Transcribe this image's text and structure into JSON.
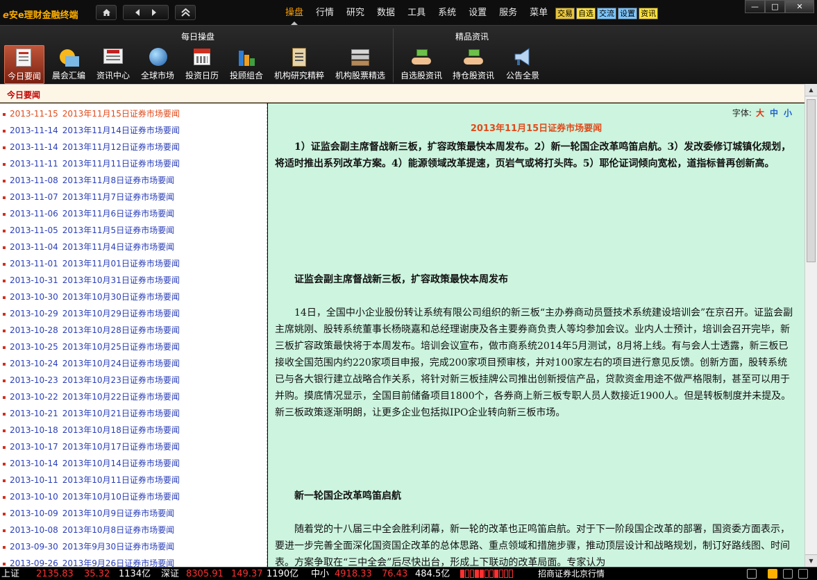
{
  "titlebar": {
    "logo_prefix": "e",
    "logo_text": "安e理财金融终端",
    "menu": [
      "操盘",
      "行情",
      "研究",
      "数据",
      "工具",
      "系统",
      "设置",
      "服务",
      "菜单"
    ],
    "active_menu": "操盘",
    "quick_buttons": [
      "交易",
      "自选",
      "交流",
      "设置",
      "资讯"
    ],
    "window_controls": [
      "—",
      "□",
      "✕"
    ]
  },
  "toolbar": {
    "group1_title": "每日操盘",
    "group2_title": "精品资讯",
    "tools": [
      {
        "label": "今日要闻",
        "icon": "newspaper-icon",
        "selected": true
      },
      {
        "label": "晨会汇编",
        "icon": "sunrise-icon"
      },
      {
        "label": "资讯中心",
        "icon": "news-screen-icon"
      },
      {
        "label": "全球市场",
        "icon": "globe-icon"
      },
      {
        "label": "投资日历",
        "icon": "calendar-icon"
      },
      {
        "label": "投顾组合",
        "icon": "bar-blocks-icon"
      },
      {
        "label": "机构研究精粹",
        "icon": "clipboard-icon"
      },
      {
        "label": "机构股票精选",
        "icon": "stack-icon"
      },
      {
        "label": "自选股资讯",
        "icon": "hand-money-icon"
      },
      {
        "label": "持仓股资讯",
        "icon": "hand-coins-icon"
      },
      {
        "label": "公告全景",
        "icon": "megaphone-icon"
      }
    ]
  },
  "section_title": "今日要闻",
  "news_list": [
    {
      "date": "2013-11-15",
      "title": "2013年11月15日证券市场要闻",
      "active": true
    },
    {
      "date": "2013-11-14",
      "title": "2013年11月14日证券市场要闻"
    },
    {
      "date": "2013-11-14",
      "title": "2013年11月12日证券市场要闻"
    },
    {
      "date": "2013-11-11",
      "title": "2013年11月11日证券市场要闻"
    },
    {
      "date": "2013-11-08",
      "title": "2013年11月8日证券市场要闻"
    },
    {
      "date": "2013-11-07",
      "title": "2013年11月7日证券市场要闻"
    },
    {
      "date": "2013-11-06",
      "title": "2013年11月6日证券市场要闻"
    },
    {
      "date": "2013-11-05",
      "title": "2013年11月5日证券市场要闻"
    },
    {
      "date": "2013-11-04",
      "title": "2013年11月4日证券市场要闻"
    },
    {
      "date": "2013-11-01",
      "title": "2013年11月01日证券市场要闻"
    },
    {
      "date": "2013-10-31",
      "title": "2013年10月31日证券市场要闻"
    },
    {
      "date": "2013-10-30",
      "title": "2013年10月30日证券市场要闻"
    },
    {
      "date": "2013-10-29",
      "title": "2013年10月29日证券市场要闻"
    },
    {
      "date": "2013-10-28",
      "title": "2013年10月28日证券市场要闻"
    },
    {
      "date": "2013-10-25",
      "title": "2013年10月25日证券市场要闻"
    },
    {
      "date": "2013-10-24",
      "title": "2013年10月24日证券市场要闻"
    },
    {
      "date": "2013-10-23",
      "title": "2013年10月23日证券市场要闻"
    },
    {
      "date": "2013-10-22",
      "title": "2013年10月22日证券市场要闻"
    },
    {
      "date": "2013-10-21",
      "title": "2013年10月21日证券市场要闻"
    },
    {
      "date": "2013-10-18",
      "title": "2013年10月18日证券市场要闻"
    },
    {
      "date": "2013-10-17",
      "title": "2013年10月17日证券市场要闻"
    },
    {
      "date": "2013-10-14",
      "title": "2013年10月14日证券市场要闻"
    },
    {
      "date": "2013-10-11",
      "title": "2013年10月11日证券市场要闻"
    },
    {
      "date": "2013-10-10",
      "title": "2013年10月10日证券市场要闻"
    },
    {
      "date": "2013-10-09",
      "title": "2013年10月9日证券市场要闻"
    },
    {
      "date": "2013-10-08",
      "title": "2013年10月8日证券市场要闻"
    },
    {
      "date": "2013-09-30",
      "title": "2013年9月30日证券市场要闻"
    },
    {
      "date": "2013-09-26",
      "title": "2013年9月26日证券市场要闻"
    }
  ],
  "article": {
    "font_label": "字体:",
    "font_big": "大",
    "font_mid": "中",
    "font_small": "小",
    "title": "2013年11月15日证券市场要闻",
    "summary": "1）证监会副主席督战新三板，扩容政策最快本周发布。2）新一轮国企改革鸣笛启航。3）发改委修订城镇化规划，将适时推出系列改革方案。4）能源领域改革提速，页岩气或将打头阵。5）耶伦证词倾向宽松，道指标普再创新高。",
    "heading1": "证监会副主席督战新三板，扩容政策最快本周发布",
    "body1": "14日，全国中小企业股份转让系统有限公司组织的新三板“主办券商动员暨技术系统建设培训会”在京召开。证监会副主席姚刚、股转系统董事长杨晓嘉和总经理谢庚及各主要券商负责人等均参加会议。业内人士预计，培训会召开完毕，新三板扩容政策最快将于本周发布。培训会议宣布，做市商系统2014年5月测试，8月将上线。有与会人士透露，新三板已接收全国范围内约220家项目申报，完成200家项目预审核，并对100家左右的项目进行意见反馈。创新方面，股转系统已与各大银行建立战略合作关系，将针对新三板挂牌公司推出创新授信产品，贷款资金用途不做严格限制，甚至可以用于并购。摸底情况显示，全国目前储备项目1800个，各券商上新三板专职人员人数接近1900人。但是转板制度并未提及。新三板政策逐渐明朗，让更多企业包括拟IPO企业转向新三板市场。",
    "heading2": "新一轮国企改革鸣笛启航",
    "body2": "随着党的十八届三中全会胜利闭幕，新一轮的改革也正鸣笛启航。对于下一阶段国企改革的部署，国资委方面表示，要进一步完善全面深化国资国企改革的总体思路、重点领域和措施步骤，推动顶层设计和战略规划，制订好路线图、时间表。方案争取在“三中全会”后尽快出台，形成上下联动的改革局面。专家认为"
  },
  "statusbar": {
    "sh_label": "上证",
    "sh_index": "2135.83",
    "sh_change": "35.32",
    "sh_volume": "1134亿",
    "sz_label": "深证",
    "sz_index": "8305.91",
    "sz_change": "149.37",
    "sz_volume": "1190亿",
    "zx_label": "中小",
    "zx_index": "4918.33",
    "zx_change": "76.43",
    "zx_volume": "484.5亿",
    "market_source": "招商证券北京行情"
  }
}
